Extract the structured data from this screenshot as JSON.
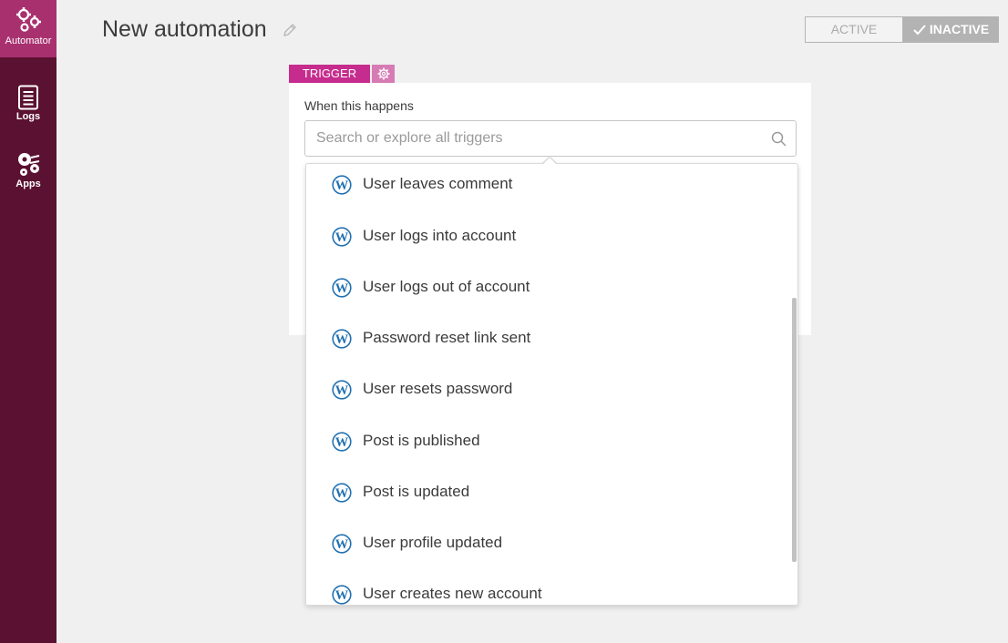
{
  "sidebar": {
    "items": [
      {
        "label": "Automator",
        "icon": "automator-gears-icon"
      },
      {
        "label": "Logs",
        "icon": "document-list-icon"
      },
      {
        "label": "Apps",
        "icon": "apps-gears-icon"
      }
    ]
  },
  "header": {
    "title": "New automation",
    "status": {
      "active_label": "ACTIVE",
      "inactive_label": "INACTIVE",
      "selected": "INACTIVE"
    }
  },
  "trigger": {
    "tag_label": "TRIGGER",
    "field_label": "When this happens",
    "search_placeholder": "Search or explore all triggers",
    "options": [
      {
        "label": "User leaves comment",
        "icon": "wordpress-icon"
      },
      {
        "label": "User logs into account",
        "icon": "wordpress-icon"
      },
      {
        "label": "User logs out of account",
        "icon": "wordpress-icon"
      },
      {
        "label": "Password reset link sent",
        "icon": "wordpress-icon"
      },
      {
        "label": "User resets password",
        "icon": "wordpress-icon"
      },
      {
        "label": "Post is published",
        "icon": "wordpress-icon"
      },
      {
        "label": "Post is updated",
        "icon": "wordpress-icon"
      },
      {
        "label": "User profile updated",
        "icon": "wordpress-icon"
      },
      {
        "label": "User creates new account",
        "icon": "wordpress-icon"
      }
    ]
  },
  "colors": {
    "sidebar_bg": "#5b1131",
    "sidebar_active": "#a8306f",
    "trigger_accent": "#c62c8d",
    "wordpress_blue": "#2271b1"
  }
}
